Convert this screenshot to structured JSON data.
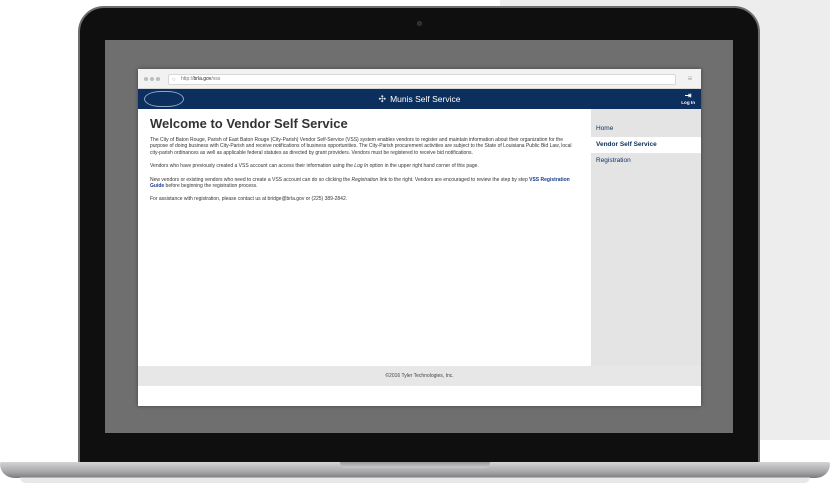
{
  "browser": {
    "url_prefix": "http://",
    "url_host": "brla.gov",
    "url_path": "/vss"
  },
  "app": {
    "title": "Munis Self Service",
    "login_label": "Log In",
    "seal_text": "CITY · PARISH SEAL"
  },
  "page": {
    "heading": "Welcome to Vendor Self Service",
    "intro": "The City of Baton Rouge, Parish of East Baton Rouge (City-Parish) Vendor Self-Service (VSS) system enables vendors to register and maintain information about their organization for the purpose of doing business with City-Parish and receive notifications of business opportunities. The City-Parish procurement activities are subject to the State of Louisiana Public Bid Law, local city-parish ordinances as well as applicable federal statutes as directed by grant providers. Vendors must be registered to receive bid notifications.",
    "returning_before": "Vendors who have previously created a VSS account can access their information using the ",
    "returning_em": "Log In",
    "returning_after": " option in the upper right hand corner of this page.",
    "new_before": "New vendors or existing vendors who need to create a VSS account can do so clicking the ",
    "new_em": "Registration",
    "new_middle": " link to the right. Vendors are encouraged to review the step by step ",
    "new_link": "VSS Registration Guide",
    "new_after": " before beginning the registration process.",
    "assistance": "For assistance with registration, please contact us at bridge@brla.gov or (225) 389-2842."
  },
  "sidebar": {
    "items": [
      {
        "label": "Home"
      },
      {
        "label": "Vendor Self Service"
      },
      {
        "label": "Registration"
      }
    ]
  },
  "footer": {
    "text": "©2016 Tyler Technologies, Inc."
  },
  "colors": {
    "brand_navy": "#0c2f5e",
    "sidebar_bg": "#e4e4e4",
    "link_blue": "#1a3b8e"
  },
  "icons": {
    "app_logo": "munis-logo-icon",
    "login": "login-arrow-icon",
    "menu": "hamburger-menu-icon",
    "url": "globe-icon"
  }
}
